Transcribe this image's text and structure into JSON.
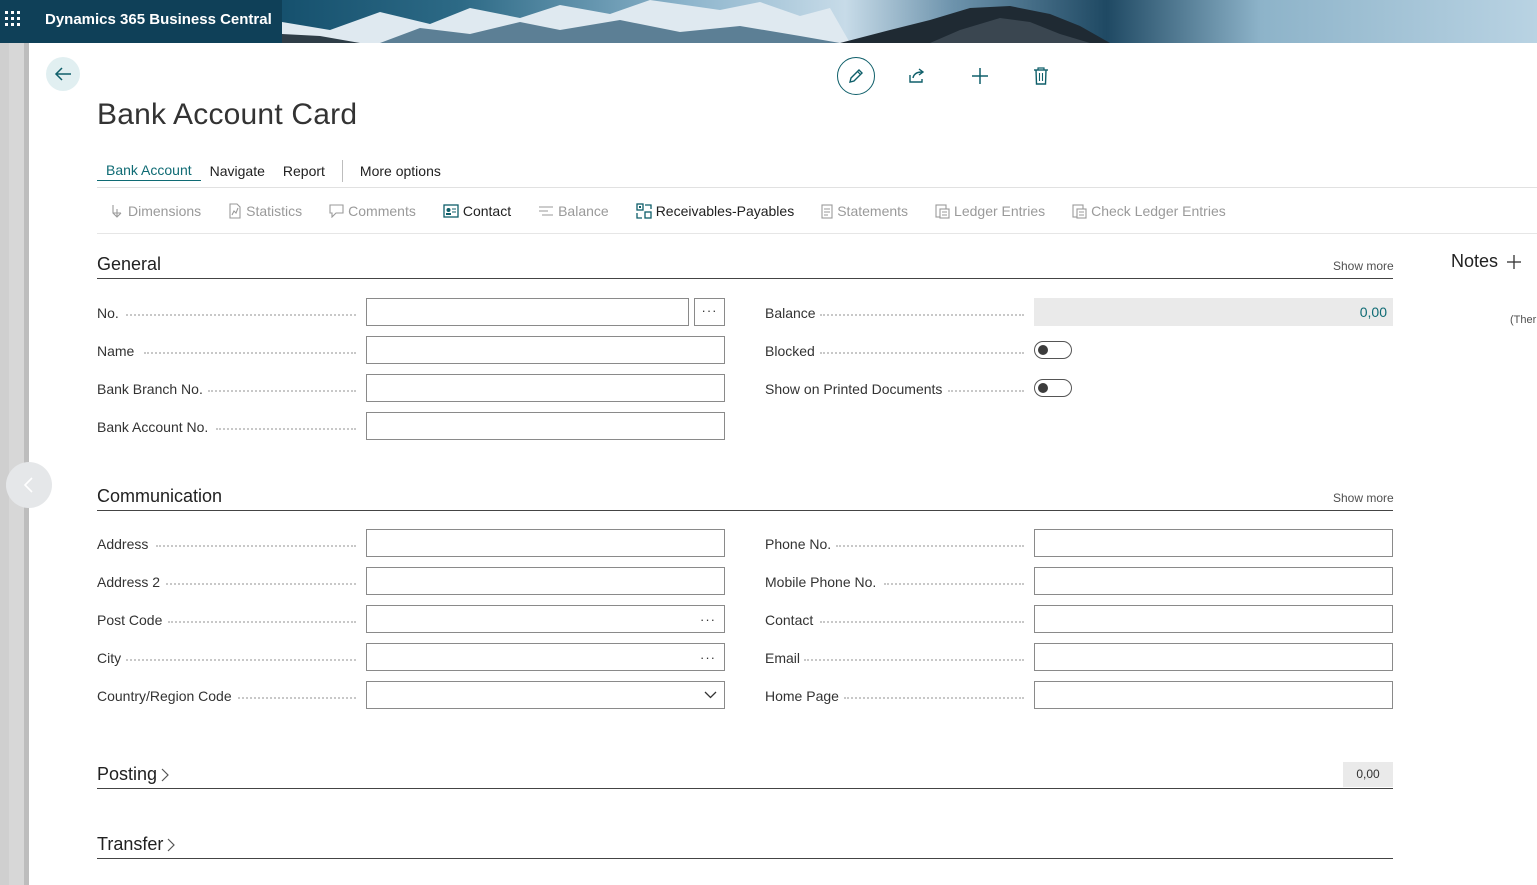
{
  "app": {
    "title": "Dynamics 365 Business Central"
  },
  "page": {
    "title": "Bank Account Card"
  },
  "menu": {
    "items": [
      "Bank Account",
      "Navigate",
      "Report"
    ],
    "more": "More options"
  },
  "actions": {
    "items": [
      "Dimensions",
      "Statistics",
      "Comments",
      "Contact",
      "Balance",
      "Receivables-Payables",
      "Statements",
      "Ledger Entries",
      "Check Ledger Entries"
    ]
  },
  "general": {
    "title": "General",
    "show_more": "Show more",
    "no_label": "No.",
    "name_label": "Name",
    "bank_branch_label": "Bank Branch No.",
    "bank_account_label": "Bank Account No.",
    "balance_label": "Balance",
    "balance_value": "0,00",
    "blocked_label": "Blocked",
    "blocked_on": false,
    "show_printed_label": "Show on Printed Documents",
    "show_printed_on": false,
    "lookup": "···"
  },
  "communication": {
    "title": "Communication",
    "show_more": "Show more",
    "address_label": "Address",
    "address2_label": "Address 2",
    "post_code_label": "Post Code",
    "city_label": "City",
    "country_label": "Country/Region Code",
    "phone_label": "Phone No.",
    "mobile_label": "Mobile Phone No.",
    "contact_label": "Contact",
    "email_label": "Email",
    "home_page_label": "Home Page",
    "lookup": "···"
  },
  "posting": {
    "title": "Posting",
    "value": "0,00"
  },
  "transfer": {
    "title": "Transfer"
  },
  "factbox": {
    "notes_title": "Notes",
    "notes_empty": "(Ther"
  },
  "colors": {
    "accent": "#0f6b74",
    "topbar": "#15506d"
  }
}
